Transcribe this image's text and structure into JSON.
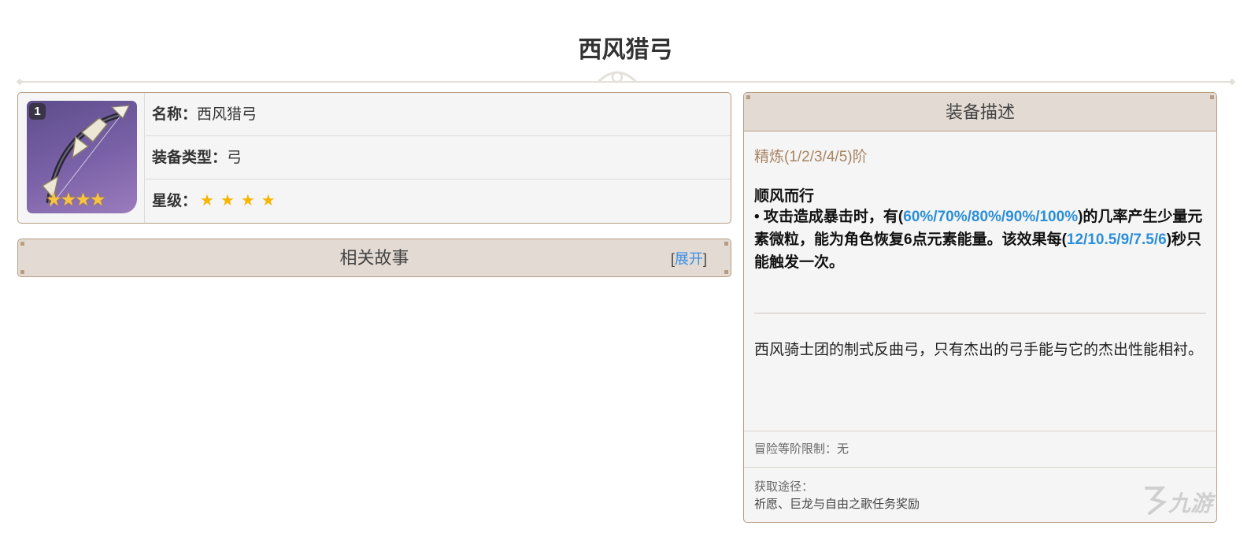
{
  "page": {
    "title": "西风猎弓"
  },
  "info": {
    "refine_badge": "1",
    "name_label": "名称：",
    "name_value": "西风猎弓",
    "type_label": "装备类型：",
    "type_value": "弓",
    "rarity_label": "星级：",
    "rarity_stars": 4,
    "rarity_glyphs": "★★★★"
  },
  "story": {
    "title": "相关故事",
    "expand_open": "[",
    "expand_label": "展开",
    "expand_close": "]"
  },
  "description": {
    "header": "装备描述",
    "refine_text": "精炼(1/2/3/4/5)阶",
    "effect_name": "顺风而行",
    "effect_part1": " • 攻击造成暴击时，有(",
    "effect_values1": "60%/70%/80%/90%/100%",
    "effect_part2": ")的几率产生少量元素微粒，能为角色恢复6点元素能量。该效果每(",
    "effect_values2": "12/10.5/9/7.5/6",
    "effect_part3": ")秒只能触发一次。",
    "flavor": "西风骑士团的制式反曲弓，只有杰出的弓手能与它的杰出性能相衬。",
    "rank_label": "冒险等阶限制：",
    "rank_value": "无",
    "source_label": "获取途径：",
    "source_value": "祈愿、巨龙与自由之歌任务奖励"
  },
  "colors": {
    "accent_blue": "#2b8fd8",
    "panel_border": "#b89d84",
    "header_bg": "#e3dbd3",
    "star": "#f7b500"
  },
  "watermark": {
    "text": "九游"
  }
}
